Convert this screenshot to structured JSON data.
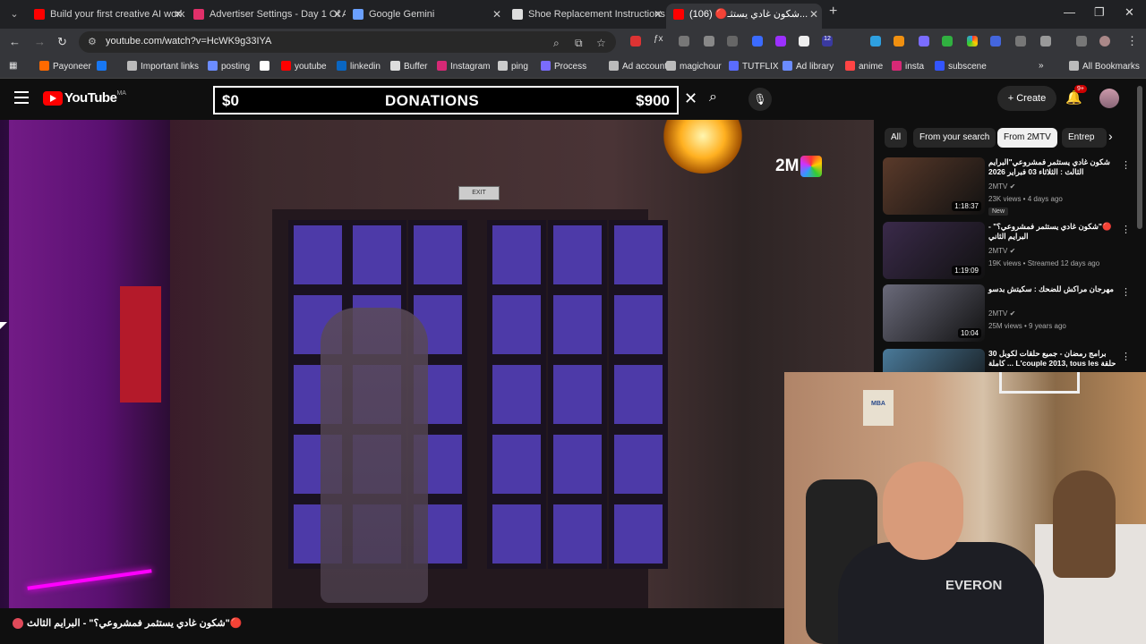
{
  "tabs": [
    {
      "title": "Build your first creative AI work",
      "color": "#ff0000"
    },
    {
      "title": "Advertiser Settings - Day 1 Of A",
      "color": "#e0306a"
    },
    {
      "title": "Google Gemini",
      "color": "#6aa0ff"
    },
    {
      "title": "Shoe Replacement Instructions",
      "color": "#dddddd"
    },
    {
      "title": "(106) 🔴شكون غادي يستثـ...",
      "color": "#ff0000"
    }
  ],
  "address": {
    "url": "youtube.com/watch?v=HcWK9g33IYA"
  },
  "extensions": {
    "badge_count": "12"
  },
  "bookmarks": [
    {
      "label": "Payoneer",
      "color": "#ff6a00"
    },
    {
      "label": "",
      "color": "#1877f2"
    },
    {
      "label": "Important links",
      "color": "#bbbbbb"
    },
    {
      "label": "posting",
      "color": "#6b8cff"
    },
    {
      "label": "",
      "color": "#ffffff"
    },
    {
      "label": "youtube",
      "color": "#ff0000"
    },
    {
      "label": "linkedin",
      "color": "#0a66c2"
    },
    {
      "label": "Buffer",
      "color": "#dddddd"
    },
    {
      "label": "Instagram",
      "color": "#d62976"
    },
    {
      "label": "ping",
      "color": "#cccccc"
    },
    {
      "label": "Process",
      "color": "#7a6cff"
    },
    {
      "label": "Ad accounts",
      "color": "#bbbbbb"
    },
    {
      "label": "magichour",
      "color": "#bbbbbb"
    },
    {
      "label": "TUTFLIX",
      "color": "#5a6cff"
    },
    {
      "label": "Ad library",
      "color": "#6b8cff"
    },
    {
      "label": "anime",
      "color": "#ff4444"
    },
    {
      "label": "insta",
      "color": "#d62976"
    },
    {
      "label": "subscene",
      "color": "#3355ff"
    }
  ],
  "bookmarks_all": "All Bookmarks",
  "youtube": {
    "logo": "YouTube",
    "region": "MA",
    "donation_left": "$0",
    "donation_mid": "DONATIONS",
    "donation_right": "$900",
    "create": "Create",
    "notif_count": "9+"
  },
  "video": {
    "watermark": "2M",
    "exit_sign": "EXIT",
    "title": "🔴\"شكون غادي يستثمر فمشروعي؟\" - البرايم الثالث",
    "channel": "2MTV"
  },
  "chips": [
    "All",
    "From your search",
    "From 2MTV",
    "Entrep"
  ],
  "recommendations": [
    {
      "title": "شكون غادي يستثمر فمشروعي\"البرايم الثالث : الثلاثاء 03 فبراير 2026",
      "channel": "2MTV",
      "meta": "23K views • 4 days ago",
      "duration": "1:18:37",
      "badge": "New",
      "thumb": "#5a3a2a"
    },
    {
      "title": "🔴\"شكون غادي يستثمر فمشروعي؟\" - البرايم الثاني",
      "channel": "2MTV",
      "meta": "19K views • Streamed 12 days ago",
      "duration": "1:19:09",
      "badge": "",
      "thumb": "#3a2a4a"
    },
    {
      "title": "مهرجان مراكش للضحك : سكيتش بدسو",
      "channel": "2MTV",
      "meta": "25M views • 9 years ago",
      "duration": "10:04",
      "badge": "",
      "thumb": "#6a6a7a"
    },
    {
      "title": "برامج رمضان - جميع حلقات لكوبل 30 حلقة L'couple 2013, tous les ... كاملة",
      "channel": "",
      "meta": "",
      "duration": "",
      "badge": "",
      "thumb": "#4a7a9a"
    }
  ],
  "webcam": {
    "brand": "EVERON",
    "sticker": "MBA"
  }
}
